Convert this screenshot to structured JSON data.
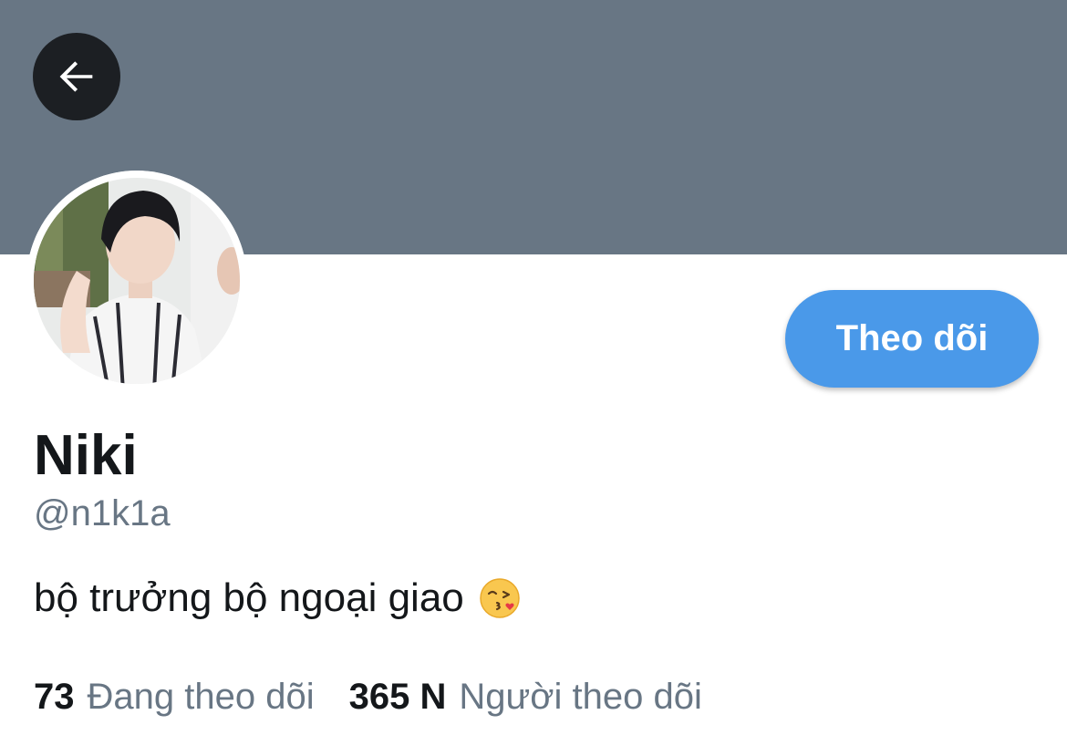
{
  "header": {
    "back_icon": "arrow-left-icon",
    "banner_color": "#687684"
  },
  "profile": {
    "avatar": "profile-photo",
    "follow_label": "Theo dõi",
    "display_name": "Niki",
    "handle": "@n1k1a",
    "bio": "bộ trưởng bộ ngoại giao",
    "bio_emoji": "face-blowing-a-kiss-emoji",
    "accent_color": "#4a99e9"
  },
  "stats": {
    "following_count": "73",
    "following_label": "Đang theo dõi",
    "followers_count": "365 N",
    "followers_label": "Người theo dõi"
  }
}
